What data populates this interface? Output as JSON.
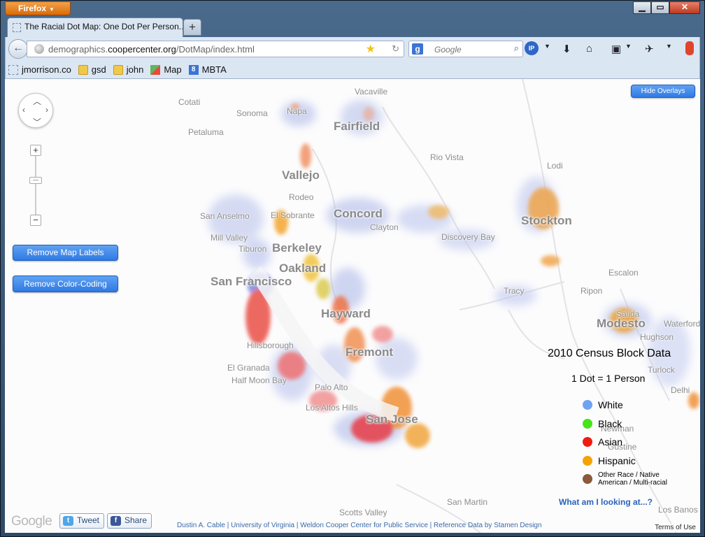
{
  "browser": {
    "app_button": "Firefox",
    "tab_title": "The Racial Dot Map: One Dot Per Person...",
    "new_tab": "+",
    "url_prefix": "demographics.",
    "url_domain": "coopercenter.org",
    "url_path": "/DotMap/index.html",
    "search_placeholder": "Google",
    "bookmarks": [
      {
        "label": "jmorrison.co",
        "icon": "dashed-page-icon"
      },
      {
        "label": "gsd",
        "icon": "folder-icon"
      },
      {
        "label": "john",
        "icon": "folder-icon"
      },
      {
        "label": "Map",
        "icon": "maps-icon"
      },
      {
        "label": "MBTA",
        "icon": "google-icon"
      }
    ]
  },
  "map": {
    "controls": {
      "hide_overlays": "Hide Overlays",
      "remove_labels": "Remove Map Labels",
      "remove_color": "Remove Color-Coding"
    },
    "cities": [
      "Fairfield",
      "Vallejo",
      "Concord",
      "Stockton",
      "Berkeley",
      "Oakland",
      "San Francisco",
      "Hayward",
      "Modesto",
      "Fremont",
      "San Jose"
    ],
    "places": [
      "Vacaville",
      "Cotati",
      "Sonoma",
      "Napa",
      "Petaluma",
      "Rio Vista",
      "Lodi",
      "Rodeo",
      "San Anselmo",
      "El Sobrante",
      "Clayton",
      "Mill Valley",
      "Tiburon",
      "Discovery Bay",
      "Escalon",
      "Tracy",
      "Ripon",
      "Salida",
      "Waterford",
      "Hillsborough",
      "Hughson",
      "El Granada",
      "Half Moon Bay",
      "Turlock",
      "Palo Alto",
      "Delhi",
      "Los Altos Hills",
      "Newman",
      "Gustine",
      "Scotts Valley",
      "San Martin",
      "Los Banos"
    ],
    "legend": {
      "title": "2010 Census Block Data",
      "subtitle": "1 Dot = 1 Person",
      "items": [
        {
          "label": "White",
          "color": "#6fa3f2"
        },
        {
          "label": "Black",
          "color": "#46e41a"
        },
        {
          "label": "Asian",
          "color": "#f01c10"
        },
        {
          "label": "Hispanic",
          "color": "#f5a300"
        },
        {
          "label": "Other Race / Native American / Multi-racial",
          "color": "#8b5a3a"
        }
      ]
    },
    "what_link": "What am I looking at...?",
    "google_logo": "Google",
    "tweet": "Tweet",
    "share": "Share",
    "credits": "Dustin A. Cable | University of Virginia | Weldon Cooper Center for Public Service | Reference Data by Stamen Design",
    "terms": "Terms of Use"
  }
}
